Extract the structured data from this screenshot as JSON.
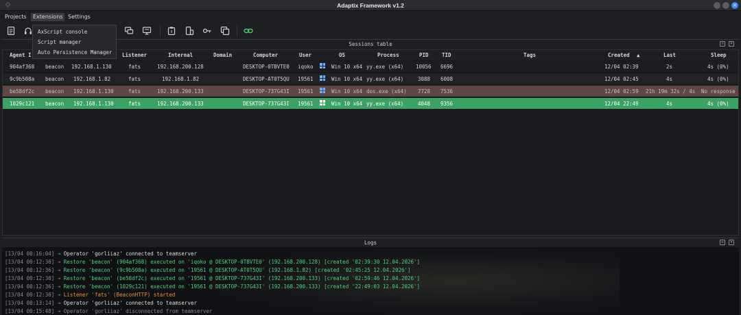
{
  "window": {
    "title": "Adaptix Framework v1.2"
  },
  "menu": {
    "projects": "Projects",
    "extensions": "Extensions",
    "settings": "Settings"
  },
  "dropdown": {
    "items": [
      "AxScript console",
      "Script manager",
      "Auto Persistence Manager"
    ]
  },
  "sessions": {
    "title": "Sessions table",
    "sort_indicator": "▲",
    "columns": {
      "agent_id": "Agent I",
      "type": "",
      "external": "",
      "listener": "Listener",
      "internal": "Internal",
      "domain": "Domain",
      "computer": "Computer",
      "user": "User",
      "os": "OS",
      "process": "Process",
      "pid": "PID",
      "tid": "TID",
      "tags": "Tags",
      "created": "Created",
      "last": "Last",
      "sleep": "Sleep"
    },
    "rows": [
      {
        "agent_id": "904af368",
        "type": "beacon",
        "external": "192.168.1.130",
        "listener": "fats",
        "internal": "192.168.200.128",
        "domain": "",
        "computer": "DESKTOP-0TBVTE0",
        "user": "iqoko",
        "os": "Win 10 x64",
        "process": "yy.exe (x64)",
        "pid": "10056",
        "tid": "6696",
        "tags": "",
        "created": "12/04 02:39",
        "last": "2s",
        "sleep": "4s (0%)"
      },
      {
        "agent_id": "9c9b508a",
        "type": "beacon",
        "external": "192.168.1.82",
        "listener": "fats",
        "internal": "192.168.1.82",
        "domain": "",
        "computer": "DESKTOP-AT0T5QU",
        "user": "19561",
        "os": "Win 10 x64",
        "process": "yy.exe (x64)",
        "pid": "3088",
        "tid": "6008",
        "tags": "",
        "created": "12/04 02:45",
        "last": "4s",
        "sleep": "4s (0%)"
      },
      {
        "agent_id": "be58df2c",
        "type": "beacon",
        "external": "192.168.1.130",
        "listener": "fats",
        "internal": "192.168.200.133",
        "domain": "",
        "computer": "DESKTOP-737G43I",
        "user": "19561",
        "os": "Win 10 x64",
        "process": "dos.exe (x64)",
        "pid": "7728",
        "tid": "7536",
        "tags": "",
        "created": "12/04 02:59",
        "last": "21h 19m 32s / 4s",
        "sleep": "No response"
      },
      {
        "agent_id": "1029c121",
        "type": "beacon",
        "external": "192.168.1.130",
        "listener": "fats",
        "internal": "192.168.200.133",
        "domain": "",
        "computer": "DESKTOP-737G43I",
        "user": "19561",
        "os": "Win 10 x64",
        "process": "yy.exe (x64)",
        "pid": "4048",
        "tid": "9356",
        "tags": "",
        "created": "12/04 22:49",
        "last": "4s",
        "sleep": "4s (0%)"
      }
    ]
  },
  "logs": {
    "title": "Logs",
    "lines": [
      {
        "ts": "[13/04 00:16:04]",
        "arrow": "→",
        "text": "Operator 'gorliiaz' connected to teamserver",
        "color": "white"
      },
      {
        "ts": "[13/04 00:12:36]",
        "arrow": "→",
        "text": "Restore 'beacon' (904af368) executed on 'iqoko @ DESKTOP-0TBVTE0' (192.168.200.128) [created '02:39:30 12.04.2026']",
        "color": "green"
      },
      {
        "ts": "[13/04 00:12:36]",
        "arrow": "→",
        "text": "Restore 'beacon' (9c9b508a) executed on '19561 @ DESKTOP-AT0T5QU' (192.168.1.82) [created '02:45:25 12.04.2026']",
        "color": "green"
      },
      {
        "ts": "[13/04 00:12:36]",
        "arrow": "→",
        "text": "Restore 'beacon' (be58df2c) executed on '19561 @ DESKTOP-737G43I' (192.168.200.133) [created '02:59:46 12.04.2026']",
        "color": "green"
      },
      {
        "ts": "[13/04 00:12:36]",
        "arrow": "→",
        "text": "Restore 'beacon' (1029c121) executed on '19561 @ DESKTOP-737G43I' (192.168.200.133) [created '22:49:03 12.04.2026']",
        "color": "green"
      },
      {
        "ts": "[13/04 00:12:36]",
        "arrow": "→",
        "text": "Listener 'fats' (BeaconHTTP) started",
        "color": "orange"
      },
      {
        "ts": "[13/04 00:13:14]",
        "arrow": "→",
        "text": "Operator 'gorliiaz' connected to teamserver",
        "color": "white"
      },
      {
        "ts": "[13/04 00:15:48]",
        "arrow": "→",
        "text": "Operator 'gorliiaz' disconnected from teamserver",
        "color": "gray"
      }
    ]
  },
  "icons": {
    "toolbar": [
      "document-icon",
      "headset-icon",
      "chat-icon",
      "monitor-icon",
      "clipboard-icon",
      "device-icon",
      "key-icon",
      "copy-icon",
      "link-icon"
    ],
    "link_color": "#4cc96a",
    "accent": "#3b82f6"
  }
}
